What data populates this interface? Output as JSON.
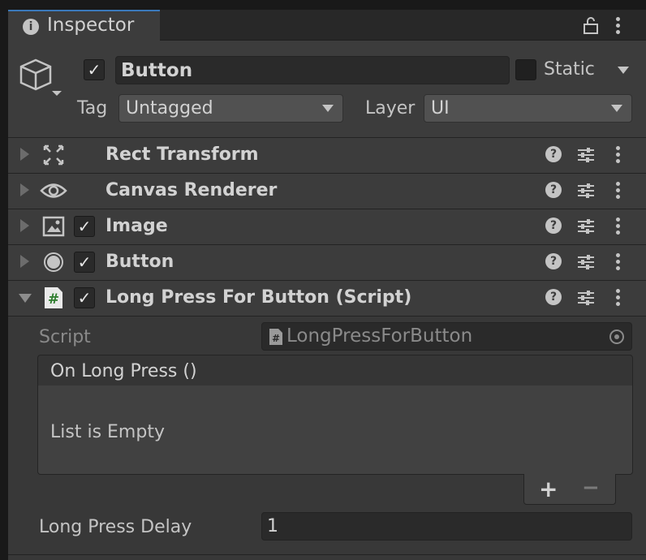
{
  "window": {
    "tab_title": "Inspector"
  },
  "header": {
    "object_name": "Button",
    "active_checked": true,
    "static_label": "Static",
    "static_checked": false,
    "tag_label": "Tag",
    "tag_value": "Untagged",
    "layer_label": "Layer",
    "layer_value": "UI"
  },
  "components": [
    {
      "title": "Rect Transform",
      "icon": "rect-transform-icon",
      "has_checkbox": false,
      "expanded": false
    },
    {
      "title": "Canvas Renderer",
      "icon": "eye-icon",
      "has_checkbox": false,
      "expanded": false
    },
    {
      "title": "Image",
      "icon": "image-icon",
      "has_checkbox": true,
      "checked": true,
      "expanded": false
    },
    {
      "title": "Button",
      "icon": "button-icon",
      "has_checkbox": true,
      "checked": true,
      "expanded": false
    },
    {
      "title": "Long Press For Button (Script)",
      "icon": "script-icon",
      "has_checkbox": true,
      "checked": true,
      "expanded": true
    }
  ],
  "script_component": {
    "script_label": "Script",
    "script_value": "LongPressForButton",
    "event_header": "On Long Press ()",
    "event_empty_text": "List is Empty",
    "add_symbol": "+",
    "remove_symbol": "−",
    "delay_label": "Long Press Delay",
    "delay_value": "1"
  },
  "colors": {
    "accent": "#3a79bb",
    "panel": "#383838",
    "header": "#3c3c3c",
    "field": "#2a2a2a"
  }
}
